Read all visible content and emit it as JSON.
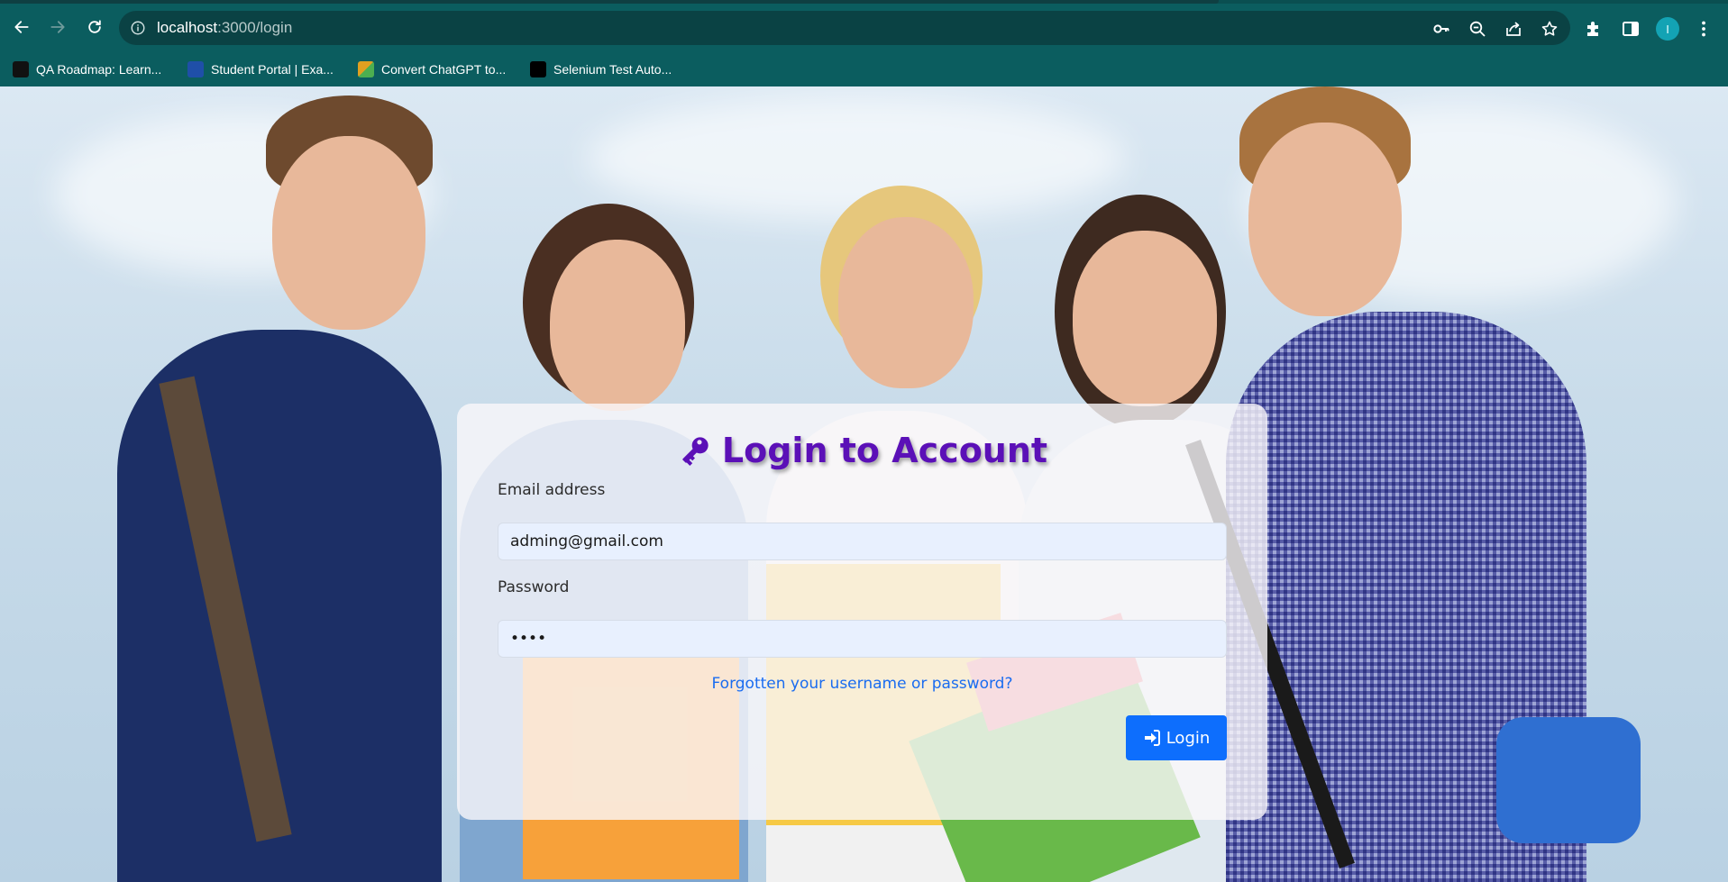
{
  "browser": {
    "url_host": "localhost",
    "url_path": ":3000/login",
    "profile_initial": "I",
    "bookmarks": [
      {
        "label": "QA Roadmap: Learn...",
        "icon": "roadmap-favicon",
        "color": "#111111"
      },
      {
        "label": "Student Portal | Exa...",
        "icon": "student-portal-favicon",
        "color": "#1f4fa8"
      },
      {
        "label": "Convert ChatGPT to...",
        "icon": "convert-chatgpt-favicon",
        "color": "#e0a020"
      },
      {
        "label": "Selenium Test Auto...",
        "icon": "medium-favicon",
        "color": "#000000"
      }
    ]
  },
  "login": {
    "title": "Login to Account",
    "title_icon": "key-icon",
    "email_label": "Email address",
    "email_value": "adming@gmail.com",
    "password_label": "Password",
    "password_value": "••••",
    "forgot_link": "Forgotten your username or password?",
    "submit_label": "Login",
    "submit_icon": "sign-in-icon"
  },
  "colors": {
    "browser_bg": "#0b5d5f",
    "title_color": "#5b10b7",
    "button_bg": "#0d6efd",
    "link_color": "#1a6cf0",
    "input_bg": "#e8f0fe"
  }
}
